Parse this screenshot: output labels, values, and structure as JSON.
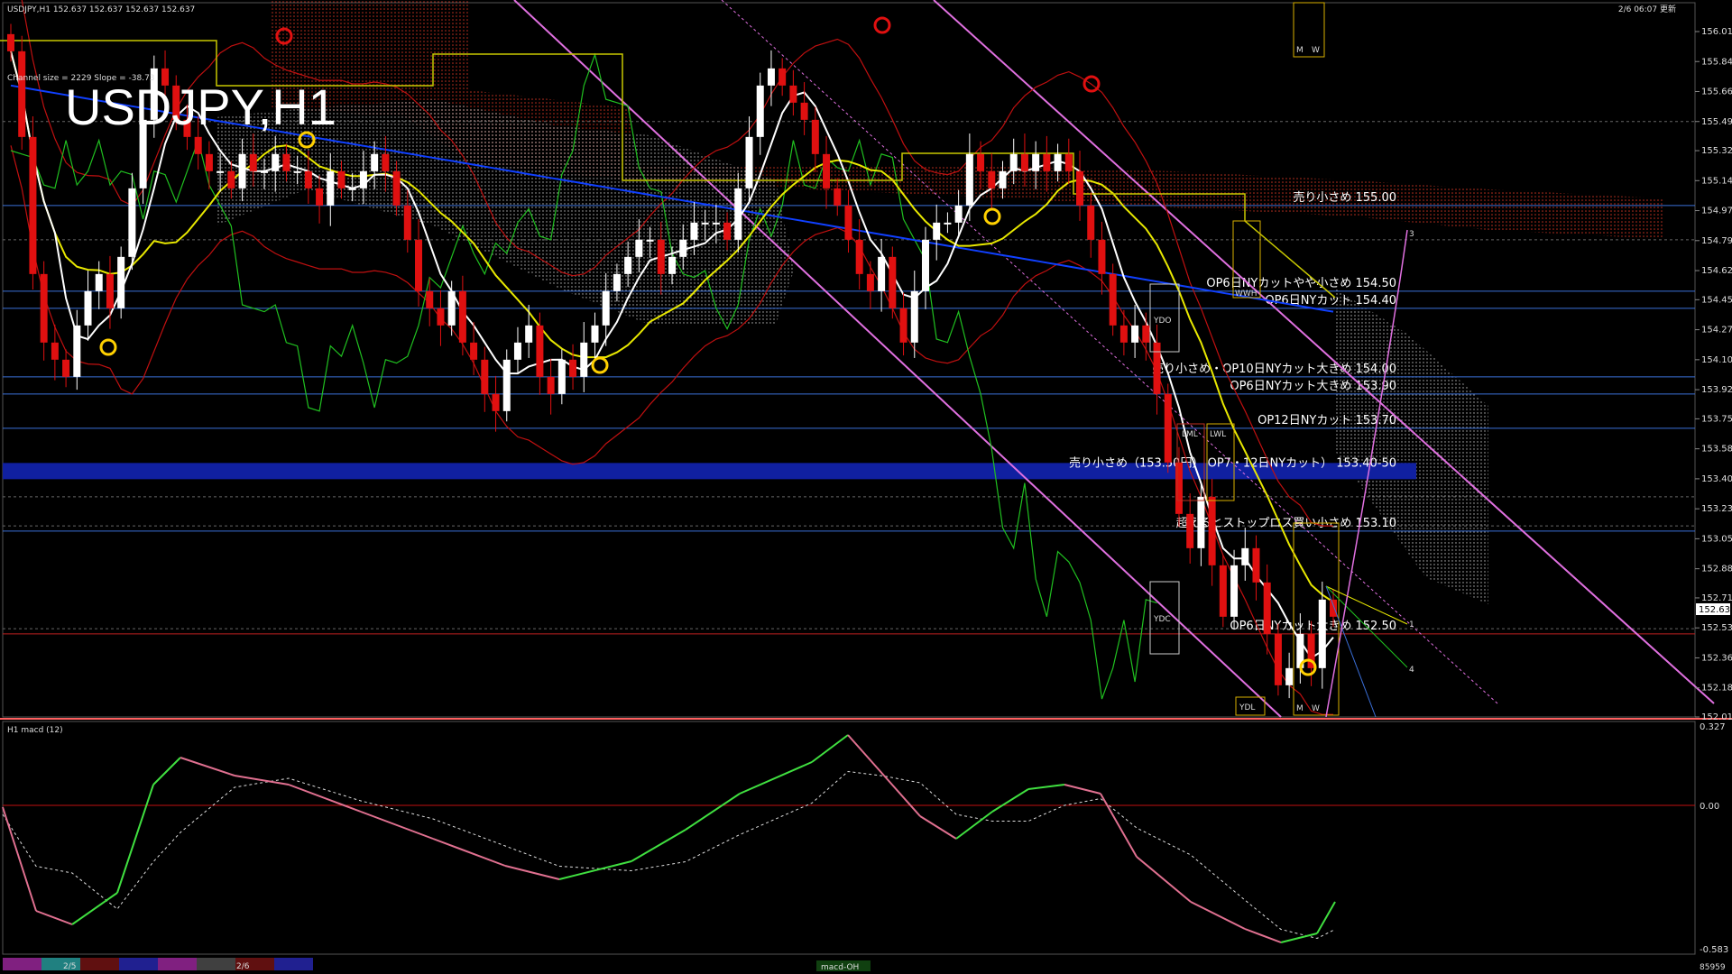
{
  "header": {
    "symbol_info": "USDJPY,H1  152.637 152.637 152.637 152.637",
    "channel_info": "Channel size = 2229 Slope = -38.73",
    "big_title": "USDJPY,H1",
    "timestamp": "2/6 06:07 更新"
  },
  "macd_panel": {
    "label": "H1  macd (12)",
    "scale_top": "0.327",
    "scale_zero": "0.00",
    "scale_bottom": "-0.583",
    "footer_right": "85959",
    "footer_center": "macd-OH"
  },
  "time_labels": [
    "2/5",
    "2/6"
  ],
  "price_ticks": [
    "156.015",
    "155.840",
    "155.665",
    "155.490",
    "155.320",
    "155.145",
    "154.970",
    "154.795",
    "154.620",
    "154.450",
    "154.275",
    "154.100",
    "153.925",
    "153.755",
    "153.580",
    "153.405",
    "153.230",
    "153.055",
    "152.880",
    "152.710",
    "152.535",
    "152.360",
    "152.185",
    "152.015"
  ],
  "current_price": "152.637",
  "levels": [
    {
      "text": "売り小さめ 155.00",
      "price": 155.0,
      "color": "#3a6fd8"
    },
    {
      "text": "OP6日NYカットやや小さめ 154.50",
      "price": 154.5,
      "color": "#3a6fd8"
    },
    {
      "text": "OP6日NYカット 154.40",
      "price": 154.4,
      "color": "#3a6fd8"
    },
    {
      "text": "売り小さめ・OP10日NYカット大きめ 154.00",
      "price": 154.0,
      "color": "#3a6fd8"
    },
    {
      "text": "OP6日NYカット大きめ 153.90",
      "price": 153.9,
      "color": "#3a6fd8"
    },
    {
      "text": "OP12日NYカット 153.70",
      "price": 153.7,
      "color": "#3a6fd8"
    },
    {
      "text": "売り小さめ（153.50円） OP7・12日NYカット） 153.40-50",
      "price": 153.45,
      "color": "#1020a0"
    },
    {
      "text": "超えるとストップロス買い小さめ 153.10",
      "price": 153.1,
      "color": "#3a6fd8"
    },
    {
      "text": "OP6日NYカット大きめ 152.50",
      "price": 152.5,
      "color": "#c02020"
    }
  ],
  "box_labels": {
    "ydo": "YDO",
    "ydc": "YDC",
    "ydl": "YDL",
    "lwl": "LWL",
    "lml": "LML",
    "wwh": "WWH",
    "m": "M",
    "w": "W"
  },
  "markers": {
    "proj1": "1",
    "proj3": "3",
    "proj4": "4"
  },
  "colors": {
    "bull": "#ffffff",
    "bear": "#e01010",
    "ma_white": "#ffffff",
    "ma_yellow": "#e8e800",
    "ma_blue": "#1040ff",
    "bollinger": "#c01010",
    "chikou": "#20c020",
    "cloud_red": "#c03020",
    "cloud_white": "#aaaaaa",
    "channel": "#e070e0",
    "macd_up": "#40e040",
    "macd_down": "#e07090"
  },
  "chart_data": {
    "type": "candlestick",
    "symbol": "USDJPY",
    "timeframe": "H1",
    "ylim": [
      152.015,
      156.015
    ],
    "close": [
      155.9,
      155.4,
      154.6,
      154.2,
      154.1,
      154.0,
      154.3,
      154.5,
      154.6,
      154.4,
      154.7,
      155.1,
      155.5,
      155.8,
      155.7,
      155.5,
      155.4,
      155.3,
      155.2,
      155.2,
      155.1,
      155.3,
      155.2,
      155.2,
      155.3,
      155.2,
      155.2,
      155.1,
      155.0,
      155.2,
      155.1,
      155.1,
      155.2,
      155.3,
      155.2,
      155.0,
      154.8,
      154.5,
      154.4,
      154.3,
      154.5,
      154.2,
      154.1,
      153.9,
      153.8,
      154.1,
      154.2,
      154.3,
      154.0,
      153.9,
      154.1,
      154.0,
      154.2,
      154.3,
      154.5,
      154.6,
      154.7,
      154.8,
      154.8,
      154.6,
      154.7,
      154.8,
      154.9,
      154.9,
      154.9,
      154.8,
      155.1,
      155.4,
      155.7,
      155.8,
      155.7,
      155.6,
      155.5,
      155.3,
      155.1,
      155.0,
      154.8,
      154.6,
      154.5,
      154.7,
      154.4,
      154.2,
      154.5,
      154.8,
      154.9,
      154.9,
      155.0,
      155.3,
      155.2,
      155.1,
      155.2,
      155.3,
      155.2,
      155.3,
      155.2,
      155.3,
      155.2,
      155.0,
      154.8,
      154.6,
      154.3,
      154.2,
      154.3,
      154.2,
      153.9,
      153.5,
      153.2,
      153.0,
      153.3,
      152.9,
      152.6,
      152.9,
      153.0,
      152.8,
      152.5,
      152.2,
      152.3,
      152.5,
      152.3,
      152.7,
      152.6
    ]
  }
}
